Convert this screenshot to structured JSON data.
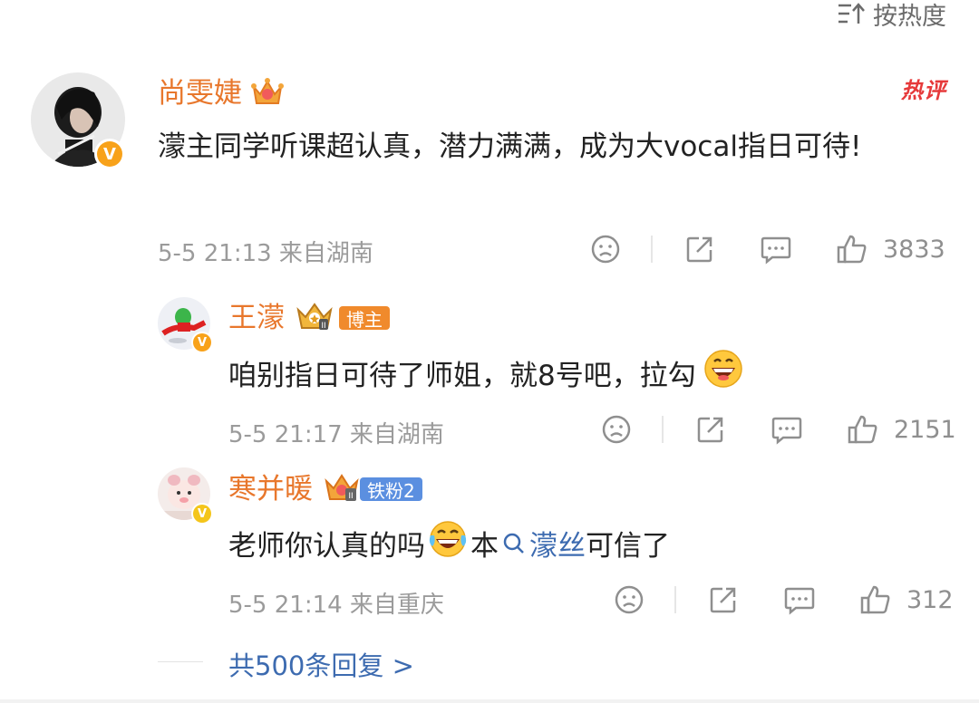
{
  "sort": {
    "label": "按热度"
  },
  "comment": {
    "user": {
      "name": "尚雯婕"
    },
    "hot_label": "热评",
    "text": "濛主同学听课超认真，潜力满满，成为大vocal指日可待!",
    "meta": "5-5 21:13 来自湖南",
    "likes": "3833"
  },
  "replies": [
    {
      "user": {
        "name": "王濛"
      },
      "badge": "博主",
      "text": "咱别指日可待了师姐，就8号吧，拉勾",
      "meta": "5-5 21:17 来自湖南",
      "likes": "2151"
    },
    {
      "user": {
        "name": "寒并暖"
      },
      "badge": "铁粉2",
      "text_before": "老师你认真的吗",
      "text_mid": "本",
      "link": "濛丝",
      "text_after": "可信了",
      "meta": "5-5 21:14 来自重庆",
      "likes": "312"
    }
  ],
  "more_replies": {
    "label": "共500条回复 >"
  },
  "colors": {
    "name": "#e8772c",
    "link": "#3d6bb0",
    "hot": "#e6393a",
    "meta": "#9b9b9b"
  }
}
